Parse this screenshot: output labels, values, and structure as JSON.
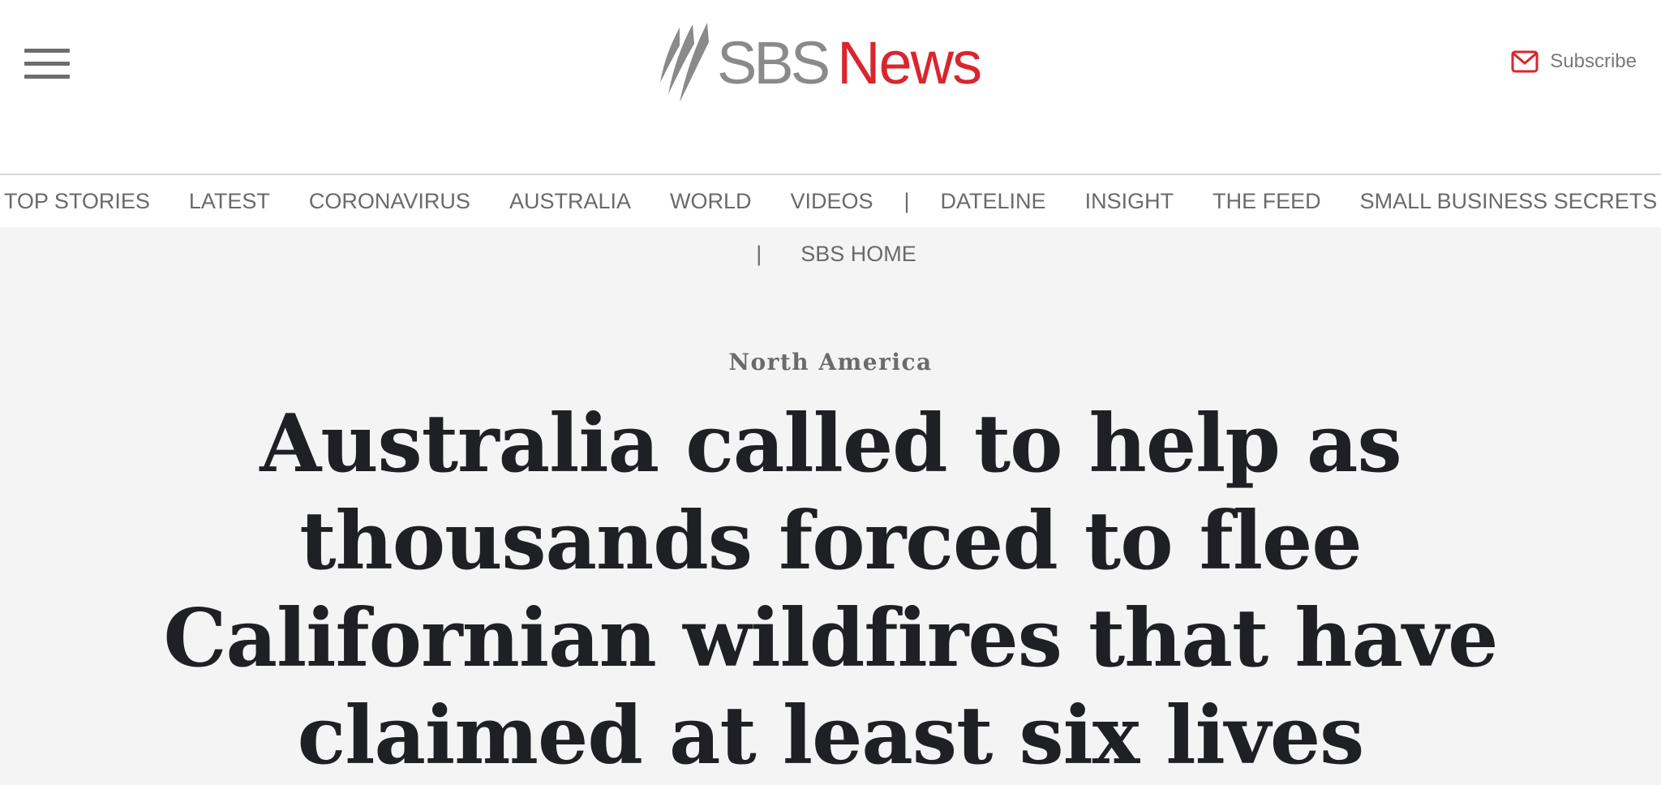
{
  "header": {
    "logo_left": "SBS",
    "logo_right": "News",
    "subscribe_label": "Subscribe",
    "icons": {
      "menu": "hamburger-menu-icon",
      "subscribe": "envelope-icon",
      "logo": "sbs-swirl-logo"
    },
    "colors": {
      "brand_red": "#d9262e",
      "logo_gray": "#8a8a8a"
    }
  },
  "nav": {
    "items": [
      "TOP STORIES",
      "LATEST",
      "CORONAVIRUS",
      "AUSTRALIA",
      "WORLD",
      "VIDEOS"
    ],
    "separator": "|",
    "items_after": [
      "DATELINE",
      "INSIGHT",
      "THE FEED",
      "SMALL BUSINESS SECRETS"
    ],
    "second_row_separator": "|",
    "second_row_item": "SBS HOME"
  },
  "article": {
    "kicker": "North America",
    "headline": "Australia called to help as thousands forced to flee Californian wildfires that have claimed at least six lives"
  }
}
